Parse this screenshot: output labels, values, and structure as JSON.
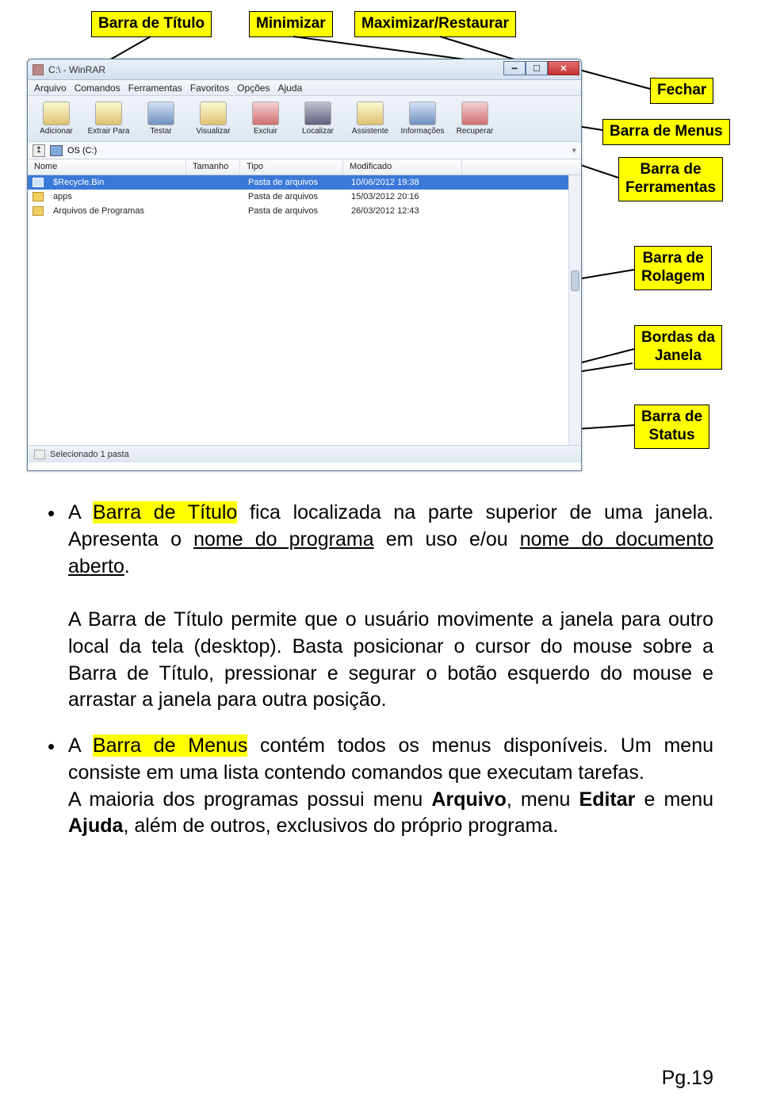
{
  "callouts": {
    "barra_titulo": "Barra de Título",
    "minimizar": "Minimizar",
    "maximizar": "Maximizar/Restaurar",
    "fechar": "Fechar",
    "barra_menus": "Barra de Menus",
    "barra_ferramentas": "Barra de\nFerramentas",
    "barra_rolagem": "Barra de\nRolagem",
    "bordas_janela": "Bordas da\nJanela",
    "barra_status": "Barra de\nStatus"
  },
  "window": {
    "title": "C:\\ - WinRAR",
    "menus": [
      "Arquivo",
      "Comandos",
      "Ferramentas",
      "Favoritos",
      "Opções",
      "Ajuda"
    ],
    "toolbar": [
      {
        "label": "Adicionar"
      },
      {
        "label": "Extrair Para"
      },
      {
        "label": "Testar"
      },
      {
        "label": "Visualizar"
      },
      {
        "label": "Excluir"
      },
      {
        "label": "Localizar"
      },
      {
        "label": "Assistente"
      },
      {
        "label": "Informações"
      },
      {
        "label": "Recuperar"
      }
    ],
    "path_label": "OS (C:)",
    "columns": {
      "nome": "Nome",
      "tamanho": "Tamanho",
      "tipo": "Tipo",
      "modificado": "Modificado"
    },
    "rows": [
      {
        "name": "$Recycle.Bin",
        "tipo": "Pasta de arquivos",
        "mod": "10/06/2012 19:38",
        "selected": true
      },
      {
        "name": "apps",
        "tipo": "Pasta de arquivos",
        "mod": "15/03/2012 20:16",
        "selected": false
      },
      {
        "name": "Arquivos de Programas",
        "tipo": "Pasta de arquivos",
        "mod": "26/03/2012 12:43",
        "selected": false
      }
    ],
    "status": "Selecionado 1 pasta"
  },
  "article": {
    "p1_a": "A ",
    "p1_b": "Barra de Título",
    "p1_c": " fica localizada na parte superior de uma janela. Apresenta o ",
    "p1_d": "nome do programa",
    "p1_e": " em uso e/ou ",
    "p1_f": "nome do documento aberto",
    "p1_g": ".",
    "p2": "A Barra de Título permite que o usuário movimente a janela para outro local da tela (desktop). Basta posicionar o cursor do mouse sobre a Barra de Título, pressionar e segurar o botão esquerdo do mouse e arrastar a janela para outra posição.",
    "p3_a": "A ",
    "p3_b": "Barra de Menus",
    "p3_c": " contém todos os menus disponíveis. Um menu consiste em uma lista contendo comandos que executam tarefas.",
    "p4_a": "A maioria dos programas possui menu ",
    "p4_b": "Arquivo",
    "p4_c": ", menu ",
    "p4_d": "Editar",
    "p4_e": " e menu ",
    "p4_f": "Ajuda",
    "p4_g": ", além de outros, exclusivos do próprio programa."
  },
  "page_number": "Pg.19"
}
